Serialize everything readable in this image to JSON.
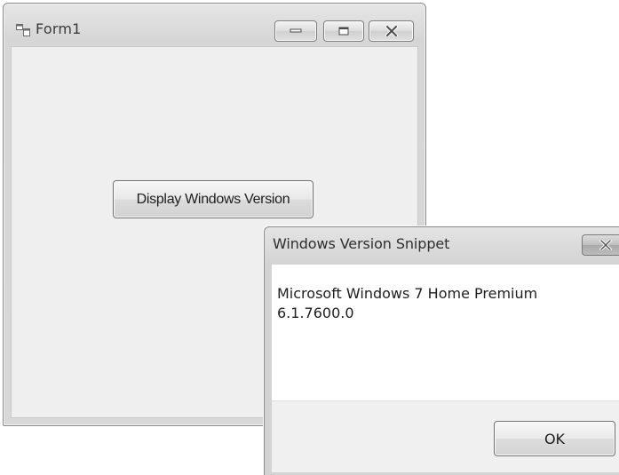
{
  "form": {
    "title": "Form1",
    "app_icon": "form-window-icon",
    "caption_buttons": [
      "minimize-icon",
      "maximize-icon",
      "close-icon"
    ],
    "display_button_label": "Display Windows Version"
  },
  "message_box": {
    "title": "Windows Version Snippet",
    "close_icon": "close-icon",
    "line1": "Microsoft Windows 7 Home Premium",
    "line2": "6.1.7600.0",
    "ok_label": "OK"
  }
}
